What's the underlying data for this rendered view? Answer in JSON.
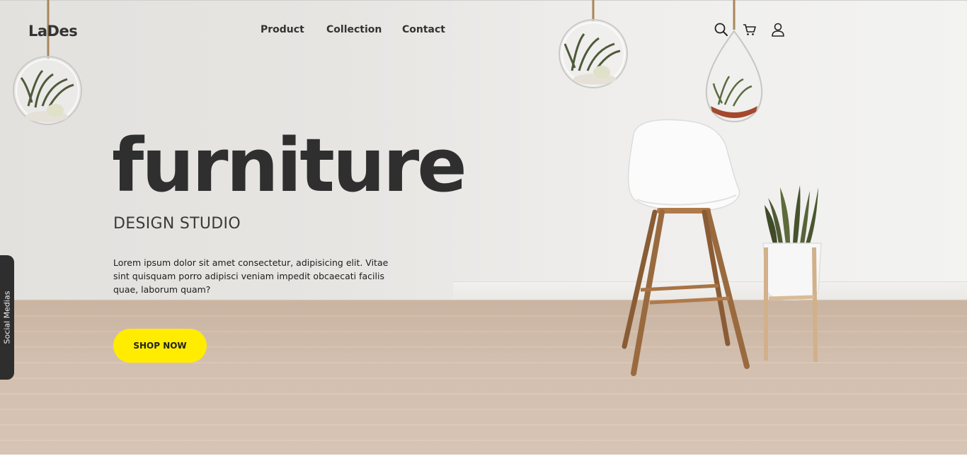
{
  "brand": {
    "logo": "LaDes"
  },
  "nav": {
    "items": [
      {
        "label": "Product"
      },
      {
        "label": "Collection"
      },
      {
        "label": "Contact"
      }
    ]
  },
  "header_icons": [
    "search-icon",
    "cart-icon",
    "user-icon"
  ],
  "hero": {
    "headline": "furniture",
    "subtitle": "DESIGN STUDIO",
    "description": "Lorem ipsum dolor sit amet consectetur, adipisicing elit. Vitae sint quisquam porro adipisci veniam impedit obcaecati facilis quae, laborum quam?",
    "cta_label": "SHOP NOW"
  },
  "social_tab": {
    "label": "Social Medias"
  },
  "colors": {
    "accent": "#ffec00",
    "text_dark": "#2f2f2f",
    "social_tab_bg": "#2e2e2e"
  }
}
